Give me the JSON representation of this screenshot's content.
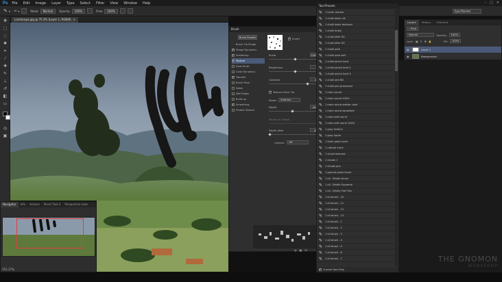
{
  "app": {
    "logo": "Ps"
  },
  "menu": [
    "File",
    "Edit",
    "Image",
    "Layer",
    "Type",
    "Select",
    "Filter",
    "View",
    "Window",
    "Help"
  ],
  "options": {
    "mode_label": "Mode:",
    "mode_value": "Normal",
    "opacity_label": "Opacity:",
    "opacity_value": "100%",
    "flow_label": "Flow:",
    "flow_value": "100%",
    "brush_size": "18"
  },
  "workspace": "Epic/Painter",
  "document": {
    "tab_title": "Landscape.jpg @ 75.2% (Layer 1, RGB/8)"
  },
  "navigator": {
    "tabs": [
      "Navigator",
      "Info",
      "Actions",
      "Pencil Tool 2",
      "Perspective tools"
    ],
    "zoom": "151.17%"
  },
  "brush_panel": {
    "title": "Brush",
    "presets_button": "Brush Presets",
    "items": [
      {
        "label": "Brush Tip Shape",
        "checked": false,
        "selected": false
      },
      {
        "label": "Shape Dynamics",
        "checked": true,
        "selected": false
      },
      {
        "label": "Scattering",
        "checked": true,
        "selected": false
      },
      {
        "label": "Texture",
        "checked": true,
        "selected": true
      },
      {
        "label": "Dual Brush",
        "checked": false,
        "selected": false
      },
      {
        "label": "Color Dynamics",
        "checked": false,
        "selected": false
      },
      {
        "label": "Transfer",
        "checked": true,
        "selected": false
      },
      {
        "label": "Brush Pose",
        "checked": false,
        "selected": false
      },
      {
        "label": "Noise",
        "checked": false,
        "selected": false
      },
      {
        "label": "Wet Edges",
        "checked": false,
        "selected": false
      },
      {
        "label": "Build-up",
        "checked": false,
        "selected": false
      },
      {
        "label": "Smoothing",
        "checked": true,
        "selected": false
      },
      {
        "label": "Protect Texture",
        "checked": false,
        "selected": false
      }
    ],
    "invert_label": "Invert",
    "scale_label": "Scale",
    "scale_value": "100%",
    "brightness_label": "Brightness",
    "brightness_value": "0",
    "contrast_label": "Contrast",
    "contrast_value": "45",
    "texture_each_tip": "Texture Each Tip",
    "mode_label": "Mode:",
    "mode_value": "Subtract",
    "depth_label": "Depth",
    "depth_value": "44%",
    "min_depth_label": "Minimum Depth",
    "depth_jitter_label": "Depth Jitter",
    "depth_jitter_value": "0%",
    "control_label": "Control:",
    "control_value": "Off"
  },
  "tool_presets": {
    "title": "Tool Presets",
    "items": [
      "1 brush marker",
      "1 chalk basic ink",
      "1 chalk basic textured",
      "1 chalk dusty",
      "1 chalk jitter DC",
      "1 chalk jitter DC",
      "1 chalk park",
      "1 chalk park soft",
      "1 chalk pencil hard",
      "1 chalk pencil hard 2",
      "1 chalk pencil hard 3",
      "1 chalk pen BG",
      "1 chalk pen pressured",
      "1 mars round",
      "1 mars round 100%",
      "1 mars round scatter color",
      "1 mars round squashed",
      "1 mars soft round",
      "1 mars soft round 100%",
      "1 gray mullins",
      "1 gray ripple",
      "1 fresh paint mark",
      "1 natural mark",
      "1 cloud textured",
      "1 clouds 1",
      "1 clouds jam",
      "1 ground plane brush",
      "1 oil - Bristle brush",
      "1 oil - Bristle Supreme",
      "1 oil - Bristly Flat Flex",
      "1 oil brush - 10",
      "1 oil brush - 11",
      "1 oil brush - 12",
      "1 oil brush - 13",
      "1 oil brush - 1",
      "1 oil brush - 2",
      "1 oil brush - 3",
      "1 oil brush - 4",
      "1 oil brush - 5",
      "1 oil brush - 6",
      "1 oil brush - 7"
    ],
    "footer": "Current Tool Only"
  },
  "layers_panel": {
    "tabs": [
      "Layers",
      "History",
      "Channels"
    ],
    "kind_label": "Kind",
    "blend_mode": "Normal",
    "opacity_label": "Opacity:",
    "opacity_value": "100%",
    "lock_label": "Lock:",
    "fill_label": "Fill:",
    "fill_value": "100%",
    "layers": [
      {
        "name": "Layer 1",
        "selected": true
      },
      {
        "name": "Background",
        "selected": false
      }
    ]
  },
  "watermark": {
    "line1": "THE GNOMON",
    "line2": "WORKSHOP"
  }
}
